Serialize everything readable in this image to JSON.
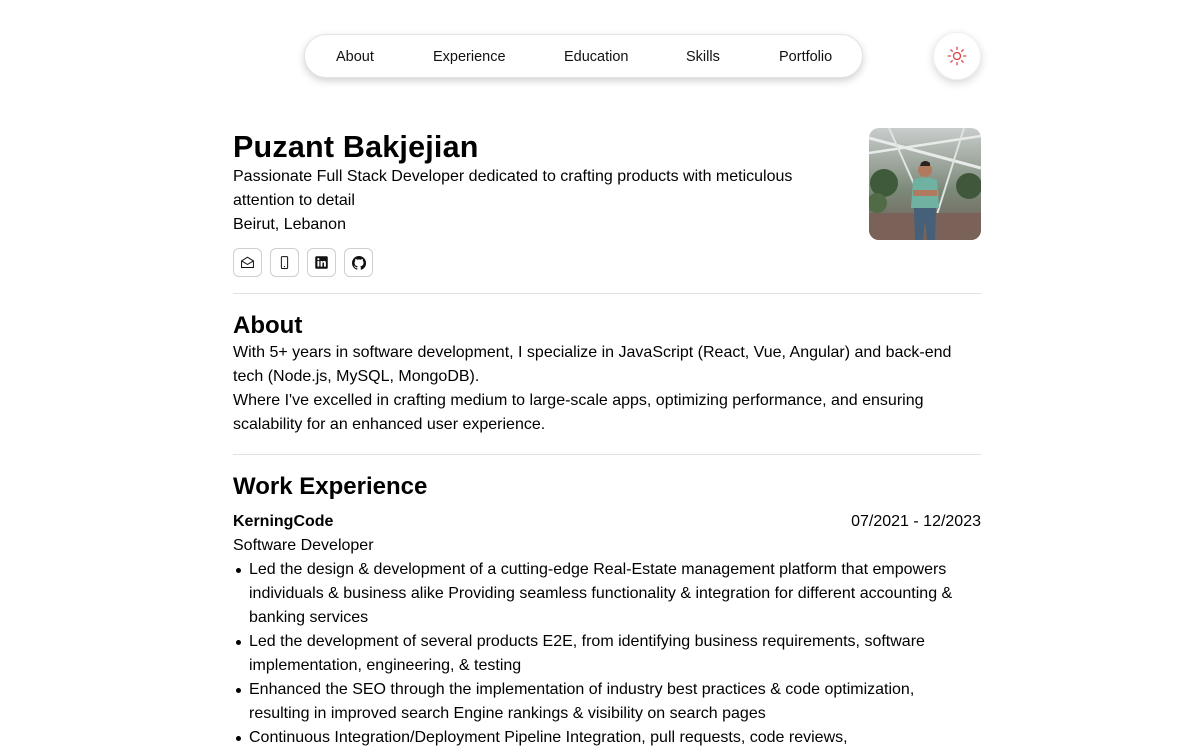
{
  "nav": {
    "items": [
      {
        "label": "About"
      },
      {
        "label": "Experience"
      },
      {
        "label": "Education"
      },
      {
        "label": "Skills"
      },
      {
        "label": "Portfolio"
      }
    ],
    "theme_icon": "sun-icon"
  },
  "header": {
    "name": "Puzant Bakjejian",
    "tagline": "Passionate Full Stack Developer dedicated to crafting products with meticulous attention to detail",
    "location": "Beirut, Lebanon",
    "contacts": [
      {
        "icon": "mail-icon"
      },
      {
        "icon": "phone-icon"
      },
      {
        "icon": "linkedin-icon"
      },
      {
        "icon": "github-icon"
      }
    ],
    "avatar": "profile-photo"
  },
  "about": {
    "title": "About",
    "paragraph1": "With 5+ years in software development, I specialize in JavaScript (React, Vue, Angular) and back-end tech (Node.js, MySQL, MongoDB).",
    "paragraph2": "Where I've excelled in crafting medium to large-scale apps, optimizing performance, and ensuring scalability for an enhanced user experience."
  },
  "experience": {
    "title": "Work Experience",
    "jobs": [
      {
        "company": "KerningCode",
        "dates": "07/2021 - 12/2023",
        "role": "Software Developer",
        "bullets": [
          "Led the design & development of a cutting-edge Real-Estate management platform that empowers individuals & business alike Providing seamless functionality & integration for different accounting & banking services",
          "Led the development of several products E2E, from identifying business requirements, software implementation, engineering, & testing",
          "Enhanced the SEO through the implementation of industry best practices & code optimization, resulting in improved search Engine rankings & visibility on search pages",
          "Continuous Integration/Deployment Pipeline Integration, pull requests, code reviews,"
        ]
      }
    ]
  },
  "colors": {
    "accent_sun": "#e0474c",
    "divider": "#e2e2e2"
  }
}
